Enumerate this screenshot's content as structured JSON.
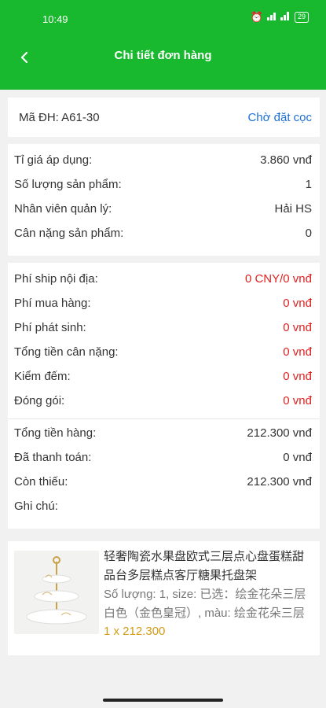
{
  "status_bar": {
    "time": "10:49",
    "battery": "29"
  },
  "header": {
    "title": "Chi tiết đơn hàng"
  },
  "order": {
    "code_label": "Mã ĐH: A61-30",
    "status": "Chờ đặt cọc"
  },
  "info": [
    {
      "label": "Tỉ giá áp dụng:",
      "value": "3.860 vnđ"
    },
    {
      "label": "Số lượng sản phẩm:",
      "value": "1"
    },
    {
      "label": "Nhân viên quản lý:",
      "value": "Hải HS"
    },
    {
      "label": "Cân nặng sản phẩm:",
      "value": "0"
    }
  ],
  "fees": [
    {
      "label": "Phí ship nội địa:",
      "value": "0 CNY/0 vnđ"
    },
    {
      "label": "Phí mua hàng:",
      "value": "0 vnđ"
    },
    {
      "label": "Phí phát sinh:",
      "value": "0 vnđ"
    },
    {
      "label": "Tổng tiền cân nặng:",
      "value": "0 vnđ"
    },
    {
      "label": "Kiểm đếm:",
      "value": "0 vnđ"
    },
    {
      "label": "Đóng gói:",
      "value": "0 vnđ"
    }
  ],
  "totals": [
    {
      "label": "Tổng tiền hàng:",
      "value": "212.300 vnđ"
    },
    {
      "label": "Đã thanh toán:",
      "value": "0 vnđ"
    },
    {
      "label": "Còn thiếu:",
      "value": "212.300 vnđ"
    },
    {
      "label": "Ghi chú:",
      "value": ""
    }
  ],
  "product": {
    "name": "轻奢陶瓷水果盘欧式三层点心盘蛋糕甜品台多层糕点客厅糖果托盘架",
    "attributes": "Số lượng: 1, size: 已选：绘金花朵三层白色（金色皇冠）, màu: 绘金花朵三层白色（金色皇冠）",
    "price": "1 x 212.300"
  },
  "colors": {
    "header_green": "#18b92e",
    "fee_red": "#e02020",
    "status_blue": "#1d6fd6",
    "price_gold": "#d39b16"
  }
}
